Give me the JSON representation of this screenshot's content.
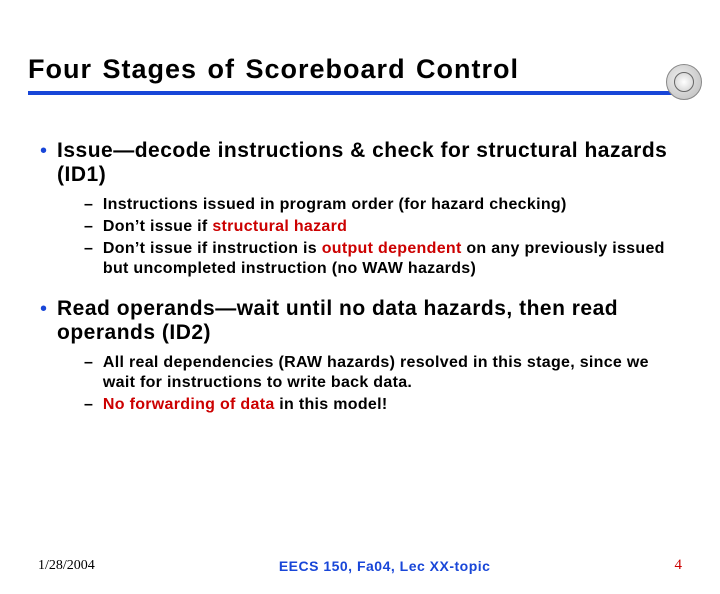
{
  "title": "Four Stages of Scoreboard Control",
  "bullets": [
    {
      "text": "Issue—decode instructions & check for structural hazards (ID1)",
      "subs": [
        {
          "plain": "Instructions issued in program order (for hazard checking)"
        },
        {
          "pre": "Don’t issue if ",
          "red": "structural hazard",
          "post": ""
        },
        {
          "pre": "Don’t issue if instruction is ",
          "red": "output dependent",
          "post": " on any previously issued but uncompleted instruction (no WAW hazards)"
        }
      ]
    },
    {
      "text": "Read operands—wait until no data hazards, then read operands (ID2)",
      "subs": [
        {
          "plain": " All real dependencies (RAW hazards) resolved in this stage, since we wait for instructions to write back data."
        },
        {
          "pre": "",
          "red": "No forwarding of data",
          "post": " in this model!"
        }
      ]
    }
  ],
  "footer": {
    "date": "1/28/2004",
    "center": "EECS 150, Fa04, Lec XX-topic",
    "page": "4"
  }
}
